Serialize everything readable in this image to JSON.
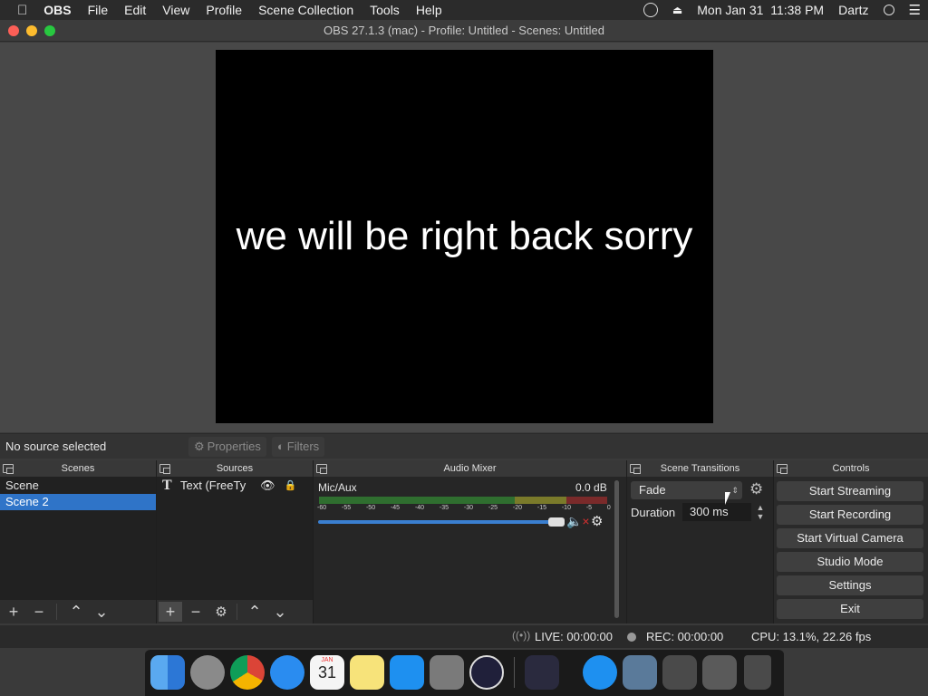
{
  "menubar": {
    "app_name": "OBS",
    "items": [
      "File",
      "Edit",
      "View",
      "Profile",
      "Scene Collection",
      "Tools",
      "Help"
    ],
    "datetime": "Mon Jan 31  11:38 PM",
    "user": "Dartz"
  },
  "window": {
    "title": "OBS 27.1.3 (mac) - Profile: Untitled - Scenes: Untitled"
  },
  "preview": {
    "text": "we will be right back sorry"
  },
  "context": {
    "status": "No source selected",
    "properties_label": "Properties",
    "filters_label": "Filters"
  },
  "docks": {
    "scenes": {
      "title": "Scenes",
      "items": [
        {
          "label": "Scene",
          "selected": false
        },
        {
          "label": "Scene 2",
          "selected": true
        }
      ]
    },
    "sources": {
      "title": "Sources",
      "items": [
        {
          "label": "Text (FreeTy",
          "type_icon": "text-icon"
        }
      ]
    },
    "audio_mixer": {
      "title": "Audio Mixer",
      "channel": "Mic/Aux",
      "level": "0.0 dB",
      "ticks": [
        "-60",
        "-55",
        "-50",
        "-45",
        "-40",
        "-35",
        "-30",
        "-25",
        "-20",
        "-15",
        "-10",
        "-5",
        "0"
      ],
      "volume": 1.0
    },
    "scene_transitions": {
      "title": "Scene Transitions",
      "transition": "Fade",
      "duration_label": "Duration",
      "duration_value": "300 ms"
    },
    "controls": {
      "title": "Controls",
      "buttons": [
        "Start Streaming",
        "Start Recording",
        "Start Virtual Camera",
        "Studio Mode",
        "Settings",
        "Exit"
      ]
    }
  },
  "status": {
    "live": "LIVE: 00:00:00",
    "rec": "REC: 00:00:00",
    "cpu": "CPU: 13.1%, 22.26 fps"
  },
  "calendar_icon": {
    "month": "JAN",
    "day": "31"
  },
  "colors": {
    "selection": "#2f74c8",
    "meter_green": "#3b8a3b",
    "meter_yellow": "#9a9a30",
    "meter_red": "#9a3030",
    "mute_red": "#d83030"
  }
}
